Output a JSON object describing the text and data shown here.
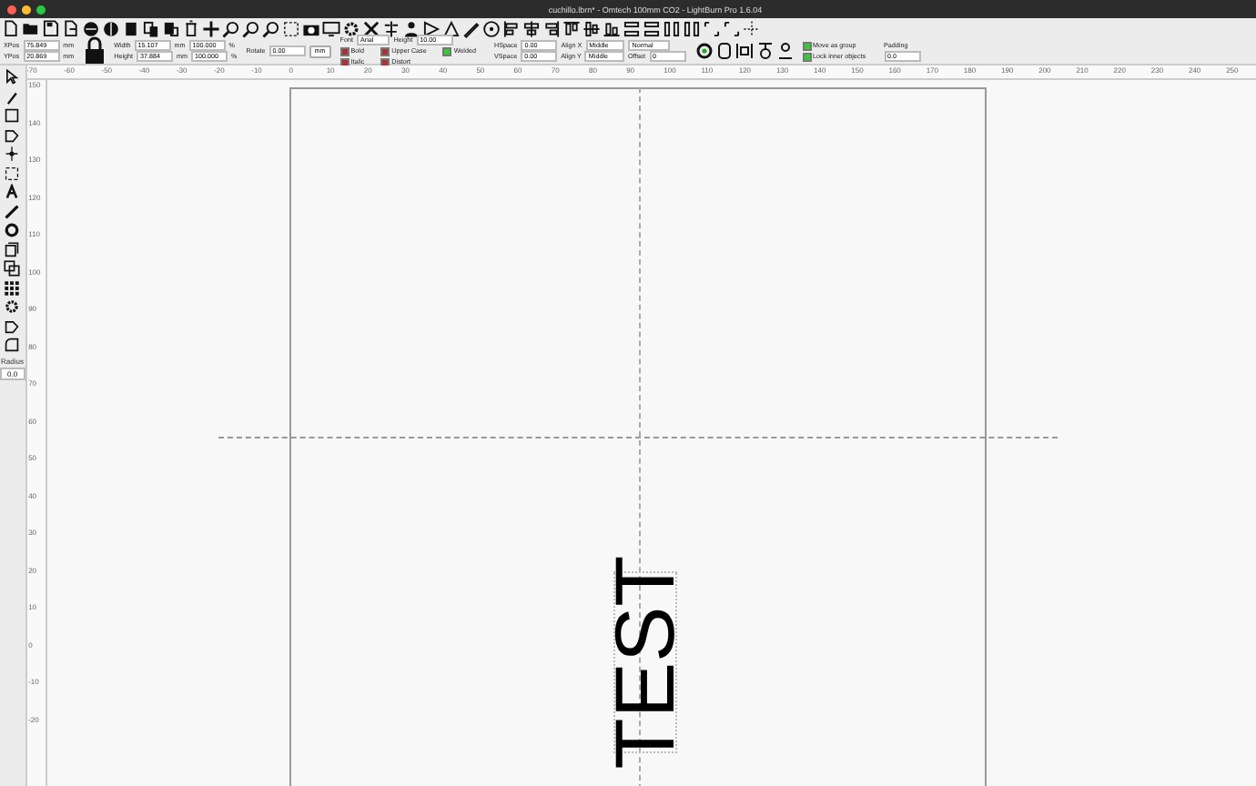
{
  "window": {
    "title": "cuchillo.lbrn* - Omtech 100mm CO2 - LightBurn Pro 1.6.04"
  },
  "property_groups": [
    {
      "rows": [
        [
          {
            "kind": "label",
            "text": "XPos"
          },
          {
            "kind": "field",
            "value": "75.849"
          },
          {
            "kind": "label",
            "text": "mm"
          }
        ],
        [
          {
            "kind": "label",
            "text": "YPos"
          },
          {
            "kind": "field",
            "value": "20.869"
          },
          {
            "kind": "label",
            "text": "mm"
          }
        ]
      ]
    },
    {
      "rows": [
        [
          {
            "kind": "lock"
          }
        ]
      ]
    },
    {
      "rows": [
        [
          {
            "kind": "label",
            "text": "Width"
          },
          {
            "kind": "field",
            "value": "15.107"
          },
          {
            "kind": "label",
            "text": "mm"
          },
          {
            "kind": "field",
            "value": "100.000"
          },
          {
            "kind": "label",
            "text": "%"
          }
        ],
        [
          {
            "kind": "label",
            "text": "Height"
          },
          {
            "kind": "field",
            "value": "37.884"
          },
          {
            "kind": "label",
            "text": "mm"
          },
          {
            "kind": "field",
            "value": "100.000"
          },
          {
            "kind": "label",
            "text": "%"
          }
        ]
      ]
    },
    {
      "rows": [
        [
          {
            "kind": "label",
            "text": "Rotate"
          },
          {
            "kind": "field",
            "value": "0.00"
          },
          {
            "kind": "button",
            "text": "mm"
          }
        ]
      ]
    },
    {
      "rows": [
        [
          {
            "kind": "label",
            "text": "Font"
          },
          {
            "kind": "dropdown",
            "value": "Arial"
          },
          {
            "kind": "label",
            "text": "Height"
          },
          {
            "kind": "field",
            "value": "10.00"
          }
        ]
      ],
      "checks": [
        {
          "kind": "check",
          "text": "Bold",
          "checked": false
        },
        {
          "kind": "check",
          "text": "Italic",
          "checked": false
        },
        {
          "kind": "check",
          "text": "Upper Case",
          "checked": false
        },
        {
          "kind": "check",
          "text": "Distort",
          "checked": false
        },
        {
          "kind": "check",
          "text": "Welded",
          "checked": true
        }
      ]
    },
    {
      "rows": [
        [
          {
            "kind": "label",
            "text": "HSpace"
          },
          {
            "kind": "field",
            "value": "0.00"
          },
          {
            "kind": "label",
            "text": "Align X"
          },
          {
            "kind": "dropdown",
            "value": "Middle"
          },
          {
            "kind": "dropdown",
            "value": "Normal"
          }
        ],
        [
          {
            "kind": "label",
            "text": "VSpace"
          },
          {
            "kind": "field",
            "value": "0.00"
          },
          {
            "kind": "label",
            "text": "Align Y"
          },
          {
            "kind": "dropdown",
            "value": "Middle"
          },
          {
            "kind": "label",
            "text": "Offset"
          },
          {
            "kind": "field",
            "value": "0"
          }
        ]
      ]
    },
    {
      "rows": [
        [
          {
            "kind": "icons"
          }
        ]
      ]
    },
    {
      "rows": [
        [
          {
            "kind": "check",
            "text": "Move as group",
            "checked": true
          }
        ],
        [
          {
            "kind": "check",
            "text": "Lock inner objects",
            "checked": true
          }
        ]
      ]
    },
    {
      "rows": [
        [
          {
            "kind": "label",
            "text": "Padding"
          }
        ],
        [
          {
            "kind": "field",
            "value": "0.0"
          }
        ]
      ]
    }
  ],
  "ruler_top": {
    "labels": [
      "-70",
      "-60",
      "-50",
      "-40",
      "-30",
      "-20",
      "-10",
      "0",
      "10",
      "20",
      "30",
      "40",
      "50",
      "60",
      "70",
      "80",
      "90",
      "100",
      "110",
      "120",
      "130",
      "140",
      "150",
      "160",
      "170",
      "180",
      "190",
      "200",
      "210",
      "220",
      "230",
      "240",
      "250"
    ]
  },
  "ruler_left": {
    "labels": [
      "150",
      "140",
      "130",
      "120",
      "110",
      "100",
      "90",
      "80",
      "70",
      "60",
      "50",
      "40",
      "30",
      "20",
      "10",
      "0",
      "-10",
      "-20"
    ]
  },
  "tools": {
    "radius_label": "Radius",
    "radius_value": "0.0"
  },
  "canvas": {
    "text": "TEST"
  }
}
